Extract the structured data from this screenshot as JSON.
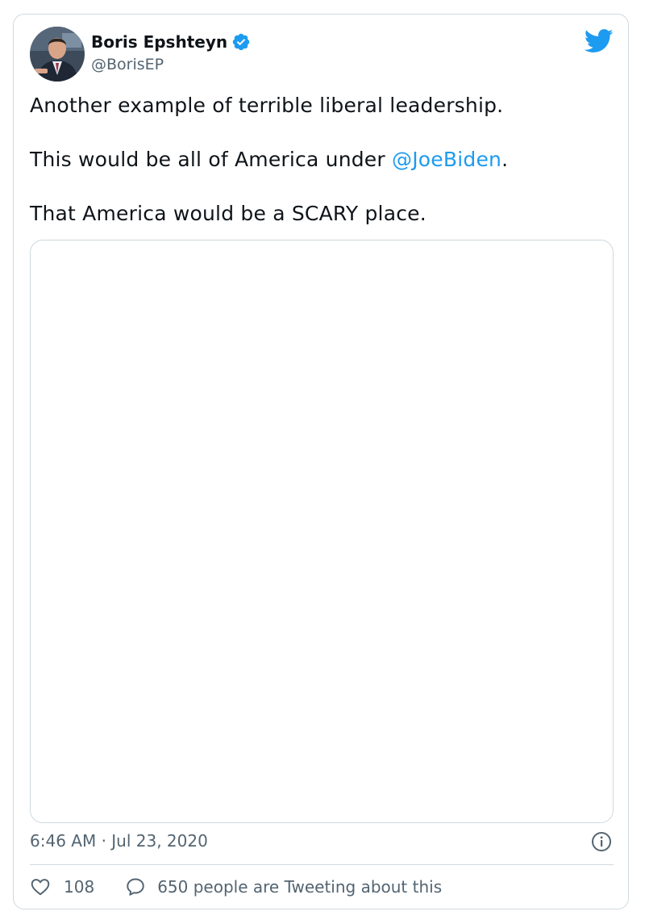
{
  "author": {
    "display_name": "Boris Epshteyn",
    "handle": "@BorisEP",
    "verified": true,
    "avatar_icon": "profile-photo"
  },
  "tweet": {
    "paragraph_1": "Another example of terrible liberal leadership.",
    "paragraph_2_prefix": "This would be all of America under ",
    "paragraph_2_mention": "@JoeBiden",
    "paragraph_2_suffix": ".",
    "paragraph_3": "That America would be a SCARY place."
  },
  "meta": {
    "timestamp": "6:46 AM · Jul 23, 2020"
  },
  "engagement": {
    "likes": "108",
    "conversation_label": "650 people are Tweeting about this"
  },
  "icons": {
    "brand": "twitter-bird-icon",
    "verified": "verified-badge-icon",
    "info": "info-icon",
    "like": "heart-icon",
    "reply": "speech-bubble-icon"
  },
  "colors": {
    "brand_blue": "#1d9bf0",
    "text_primary": "#0f1419",
    "text_secondary": "#536471",
    "border": "#cfd9de"
  }
}
